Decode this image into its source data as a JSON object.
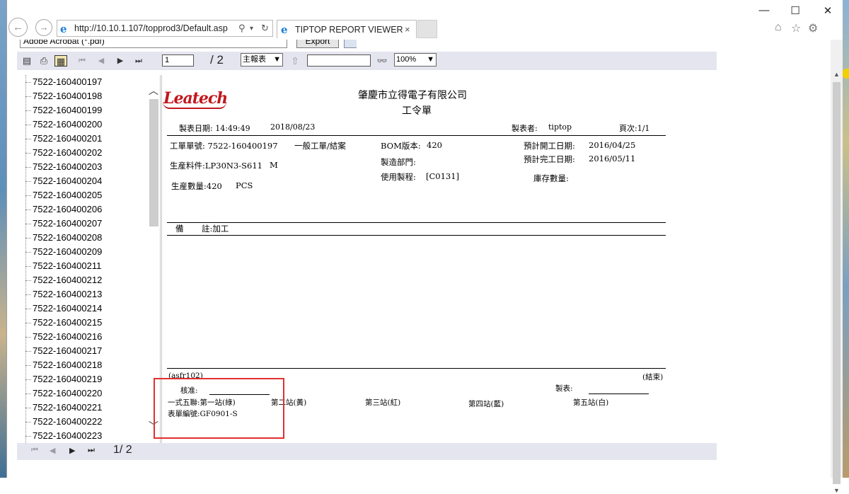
{
  "browser": {
    "address": "http://10.10.1.107/topprod3/Default.asp",
    "tab_title": "TIPTOP REPORT VIEWER",
    "back_glyph": "←",
    "forward_glyph": "→",
    "search_glyph": "⚲",
    "dropdown_glyph": "▾",
    "refresh_glyph": "↻",
    "close_glyph": "×",
    "window_controls": {
      "minimize": "—",
      "maximize": "☐",
      "close": "✕"
    },
    "icons": [
      "home-icon",
      "star-icon",
      "gear-icon",
      "smiley-icon"
    ]
  },
  "viewer": {
    "export_format": "Adobe Acrobat (*.pdf)",
    "export_label": "Export",
    "current_page": "1",
    "total_pages": "/ 2",
    "report_selector": "主報表",
    "zoom": "100%",
    "bottom_page_indicator": "1/ 2",
    "nav_first": "⏮",
    "nav_prev": "◀",
    "nav_next": "▶",
    "nav_last": "⏭",
    "search_glyph": "🔍",
    "up_glyph": "⇧",
    "scroll_up": "︿",
    "scroll_down": "﹀"
  },
  "tree": {
    "items": [
      "7522-160400197",
      "7522-160400198",
      "7522-160400199",
      "7522-160400200",
      "7522-160400201",
      "7522-160400202",
      "7522-160400203",
      "7522-160400204",
      "7522-160400205",
      "7522-160400206",
      "7522-160400207",
      "7522-160400208",
      "7522-160400209",
      "7522-160400211",
      "7522-160400212",
      "7522-160400213",
      "7522-160400214",
      "7522-160400215",
      "7522-160400216",
      "7522-160400217",
      "7522-160400218",
      "7522-160400219",
      "7522-160400220",
      "7522-160400221",
      "7522-160400222",
      "7522-160400223"
    ]
  },
  "report": {
    "logo_text": "Leatech",
    "company": "肇慶市立得電子有限公司",
    "title": "工令單",
    "print_date_label": "製表日期: 14:49:49",
    "print_date": "2018/08/23",
    "maker_label": "製表者:",
    "maker": "tiptop",
    "page_label": "頁次:1/1",
    "order_no": "工單單號: 7522-160400197",
    "order_type": "一般工單/結案",
    "part_no": "生産料件:LP30N3-S611",
    "part_suffix": "M",
    "qty": "生産數量:420",
    "unit": "PCS",
    "bom_label": "BOM版本:",
    "bom_value": "420",
    "dept_label": "製造部門:",
    "process_label": "使用製程:",
    "process_value": "[C0131]",
    "plan_start_label": "預計開工日期:",
    "plan_start": "2016/04/25",
    "plan_end_label": "預計完工日期:",
    "plan_end": "2016/05/11",
    "stock_label": "庫存數量:",
    "remark_label": "備",
    "remark_value": "註:加工",
    "program_id": "(asfr102)",
    "end_mark": "(結束)",
    "approve_label": "核准:",
    "maker_sign_label": "製表:",
    "copies_label": "一式五聯:第一站(綠)",
    "station2": "第二站(黃)",
    "station3": "第三站(紅)",
    "station4": "第四站(藍)",
    "station5": "第五站(白)",
    "form_no": "表單編號:GF0901-S"
  }
}
